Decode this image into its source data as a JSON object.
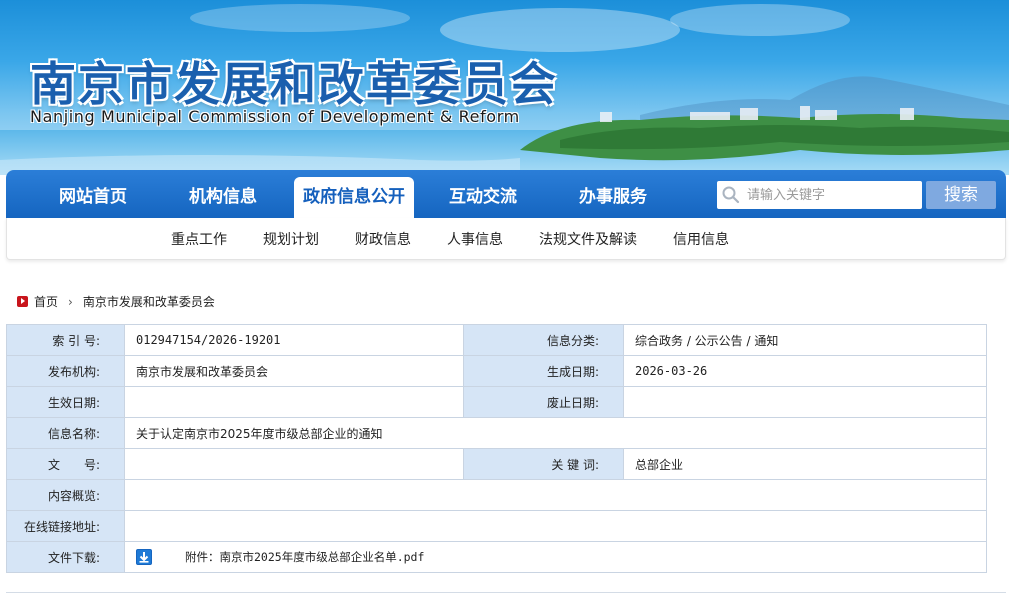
{
  "header": {
    "title_cn": "南京市发展和改革委员会",
    "title_en": "Nanjing Municipal Commission of Development & Reform"
  },
  "nav": {
    "items": [
      {
        "label": "网站首页",
        "active": false
      },
      {
        "label": "机构信息",
        "active": false
      },
      {
        "label": "政府信息公开",
        "active": true
      },
      {
        "label": "互动交流",
        "active": false
      },
      {
        "label": "办事服务",
        "active": false
      }
    ],
    "search_placeholder": "请输入关键字",
    "search_button": "搜索"
  },
  "sub_nav": {
    "items": [
      "重点工作",
      "规划计划",
      "财政信息",
      "人事信息",
      "法规文件及解读",
      "信用信息"
    ]
  },
  "breadcrumb": {
    "home": "首页",
    "current": "南京市发展和改革委员会"
  },
  "info_table": {
    "index_label": "索 引 号:",
    "index_value": "012947154/2026-19201",
    "category_label": "信息分类:",
    "category_value": "综合政务 / 公示公告 / 通知",
    "publisher_label": "发布机构:",
    "publisher_value": "南京市发展和改革委员会",
    "created_label": "生成日期:",
    "created_value": "2026-03-26",
    "effective_label": "生效日期:",
    "effective_value": "",
    "expiry_label": "废止日期:",
    "expiry_value": "",
    "name_label": "信息名称:",
    "name_value": "关于认定南京市2025年度市级总部企业的通知",
    "doc_no_label": "文　　号:",
    "doc_no_value": "",
    "keywords_label": "关 键 词:",
    "keywords_value": "总部企业",
    "overview_label": "内容概览:",
    "overview_value": "",
    "link_label": "在线链接地址:",
    "link_value": "",
    "download_label": "文件下载:",
    "download_file": "附件：南京市2025年度市级总部企业名单.pdf"
  },
  "colors": {
    "nav_blue": "#1565c0",
    "label_bg": "#d6e5f6",
    "title_blue": "#1a5fae",
    "home_icon_red": "#c8151c"
  }
}
